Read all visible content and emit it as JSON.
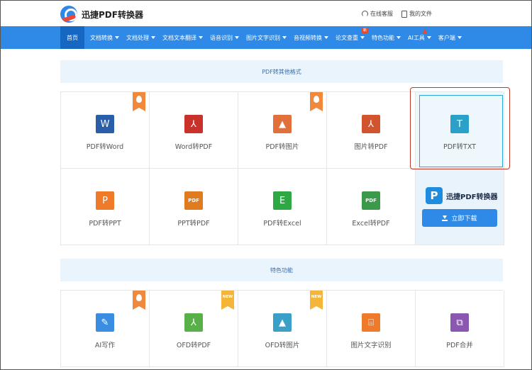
{
  "header": {
    "app_name": "迅捷PDF转换器",
    "links": [
      {
        "label": "在线客服",
        "icon": "headset-icon"
      },
      {
        "label": "我的文件",
        "icon": "document-icon"
      }
    ]
  },
  "nav": {
    "items": [
      {
        "label": "首页",
        "active": true
      },
      {
        "label": "文档转换"
      },
      {
        "label": "文档处理"
      },
      {
        "label": "文档文本翻译"
      },
      {
        "label": "语音识别"
      },
      {
        "label": "图片文字识别"
      },
      {
        "label": "音视频转换"
      },
      {
        "label": "论文查重",
        "badge": "新"
      },
      {
        "label": "特色功能"
      },
      {
        "label": "AI工具"
      },
      {
        "label": "客户端"
      }
    ]
  },
  "section1": {
    "title": "PDF转其他格式",
    "tiles": [
      {
        "label": "PDF转Word",
        "icon": "word-icon",
        "glyph": "W",
        "color": "#2b5ea8",
        "ribbon": "hot"
      },
      {
        "label": "Word转PDF",
        "icon": "pdf-icon",
        "glyph": "⅄",
        "color": "#c8322a"
      },
      {
        "label": "PDF转图片",
        "icon": "image-icon",
        "glyph": "▲",
        "color": "#e2703a",
        "ribbon": "hot"
      },
      {
        "label": "图片转PDF",
        "icon": "pdf-icon",
        "glyph": "⅄",
        "color": "#d2542e"
      },
      {
        "label": "PDF转TXT",
        "icon": "txt-icon",
        "glyph": "T",
        "color": "#2ba0c8",
        "selected": true
      },
      {
        "label": "PDF转PPT",
        "icon": "powerpoint-icon",
        "glyph": "P",
        "color": "#ee7a2a"
      },
      {
        "label": "PPT转PDF",
        "icon": "pdf-icon",
        "glyph": "PDF",
        "color": "#e07b1f"
      },
      {
        "label": "PDF转Excel",
        "icon": "excel-icon",
        "glyph": "E",
        "color": "#2da843"
      },
      {
        "label": "Excel转PDF",
        "icon": "pdf-icon",
        "glyph": "PDF",
        "color": "#3a9a4a"
      }
    ],
    "promo": {
      "app_name": "迅捷PDF转换器",
      "logo_glyph": "P",
      "button_label": "立即下载"
    }
  },
  "section2": {
    "title": "特色功能",
    "tiles": [
      {
        "label": "AI写作",
        "icon": "pen-icon",
        "glyph": "✎",
        "color": "#3a8de0",
        "ribbon": "hot"
      },
      {
        "label": "OFD转PDF",
        "icon": "pdf-icon",
        "glyph": "⅄",
        "color": "#58b048",
        "ribbon": "new",
        "ribbon_text": "NEW"
      },
      {
        "label": "OFD转图片",
        "icon": "image-icon",
        "glyph": "▲",
        "color": "#3aa0c8",
        "ribbon": "new",
        "ribbon_text": "NEW"
      },
      {
        "label": "图片文字识别",
        "icon": "ocr-icon",
        "glyph": "⌸",
        "color": "#ee7a2a"
      },
      {
        "label": "PDF合并",
        "icon": "merge-icon",
        "glyph": "⧉",
        "color": "#8a58b0"
      }
    ]
  }
}
